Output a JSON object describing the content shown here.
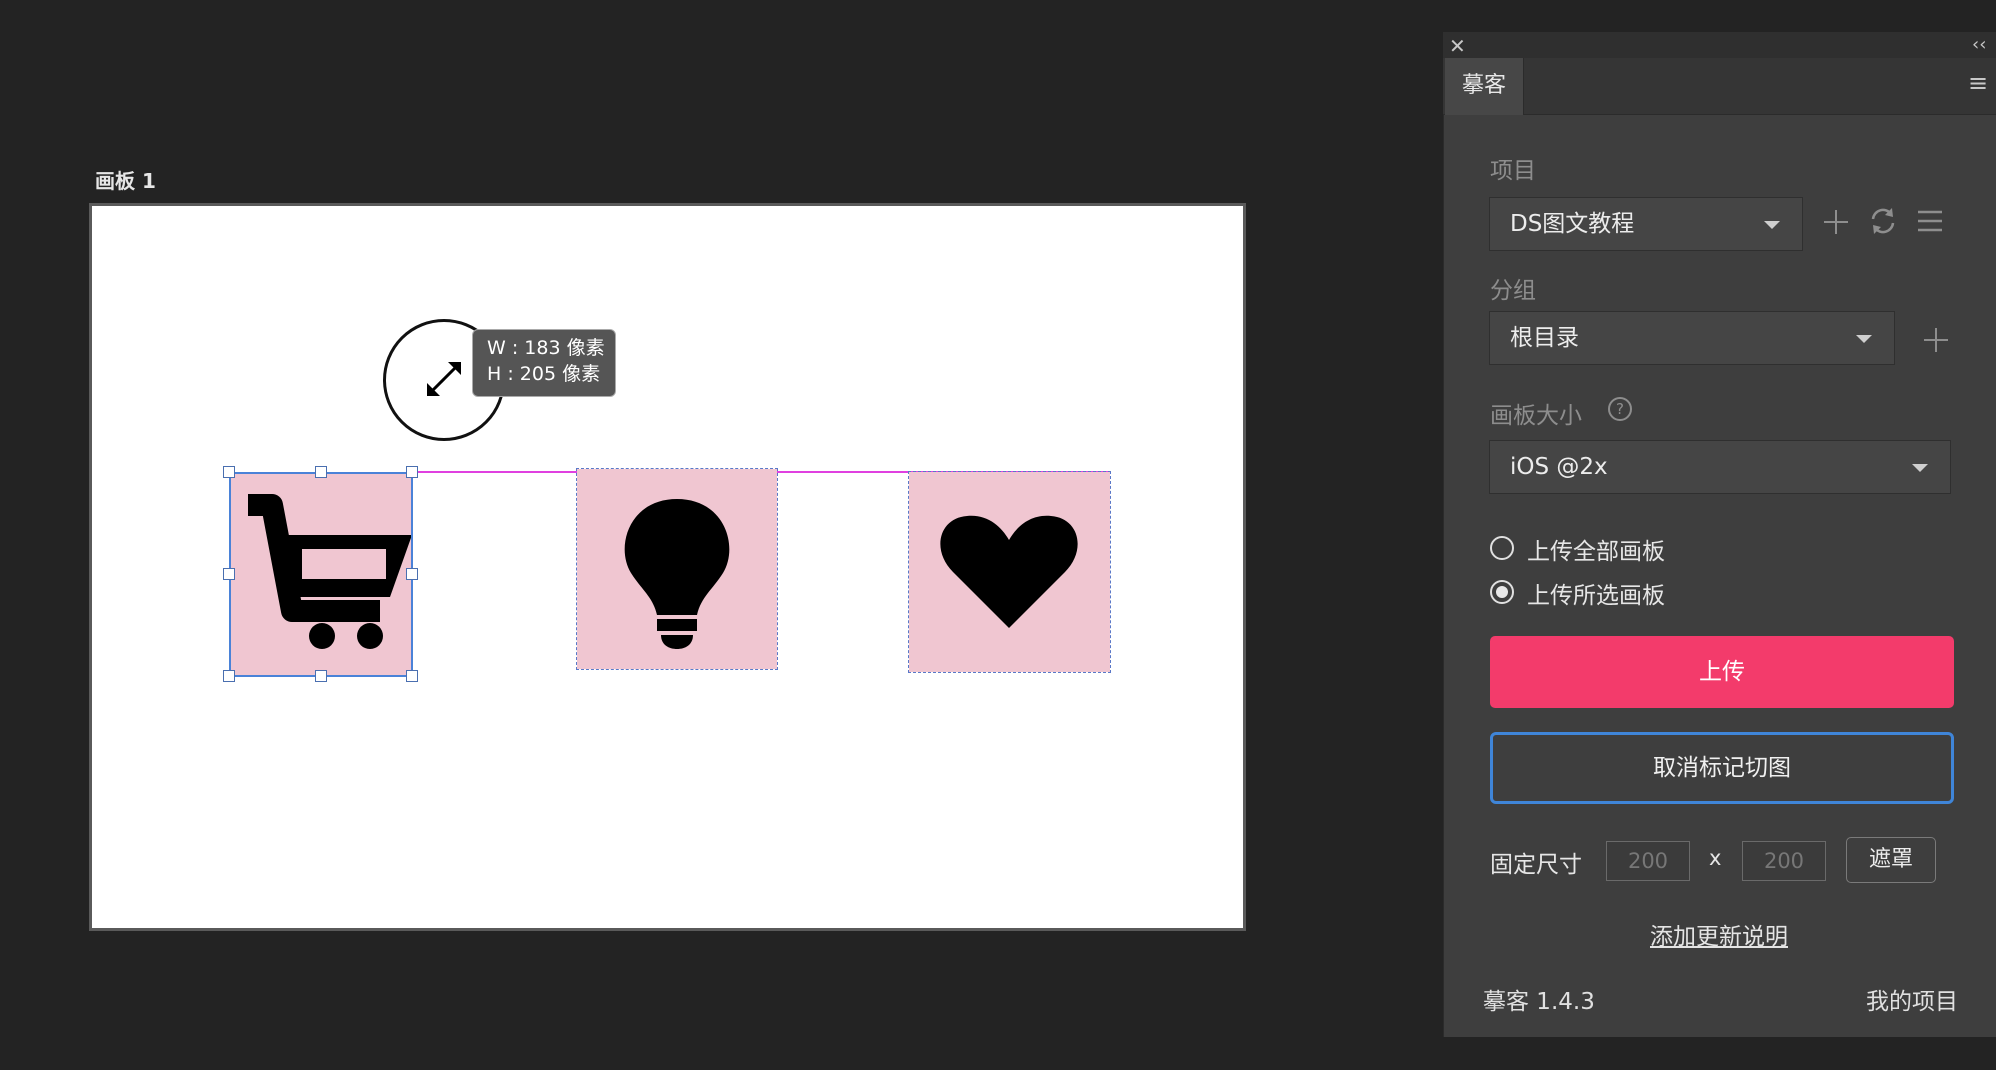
{
  "canvas": {
    "artboard_title": "画板 1",
    "measure_tooltip": {
      "width_text": "W : 183 像素",
      "height_text": "H : 205 像素"
    },
    "icons": [
      "shopping-cart",
      "lightbulb",
      "heart"
    ],
    "tile_color": "#f0c6d1",
    "guide_color": "#e040e0",
    "selection_color": "#4a82d8"
  },
  "panel": {
    "close_glyph": "✕",
    "collapse_glyph": "‹‹",
    "menu_glyph": "≡",
    "tab_label": "摹客",
    "project_label": "项目",
    "project_value": "DS图文教程",
    "group_label": "分组",
    "group_value": "根目录",
    "artboard_size_label": "画板大小",
    "help_glyph": "?",
    "artboard_size_value": "iOS @2x",
    "radio_options": [
      {
        "label": "上传全部画板",
        "checked": false
      },
      {
        "label": "上传所选画板",
        "checked": true
      }
    ],
    "upload_button": "上传",
    "unmark_button": "取消标记切图",
    "fixed_size_label": "固定尺寸",
    "fixed_width_placeholder": "200",
    "size_separator": "x",
    "fixed_height_placeholder": "200",
    "mask_button": "遮罩",
    "add_update_note_link": "添加更新说明",
    "version_text": "摹客 1.4.3",
    "my_projects_link": "我的项目",
    "accent_color": "#f33b6b",
    "focus_color": "#3f85d8"
  }
}
